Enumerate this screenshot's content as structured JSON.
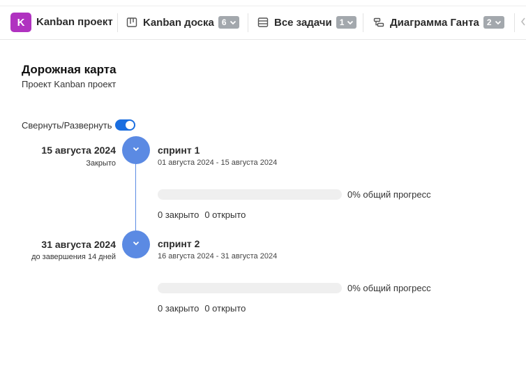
{
  "header": {
    "project_initial": "K",
    "project_name": "Kanban проект",
    "project_color": "#b032c0",
    "tabs": [
      {
        "label": "Kanban доска",
        "badge": "6",
        "icon": "board-icon"
      },
      {
        "label": "Все задачи",
        "badge": "1",
        "icon": "list-icon"
      },
      {
        "label": "Диаграмма Ганта",
        "badge": "2",
        "icon": "gantt-icon"
      }
    ]
  },
  "page": {
    "title": "Дорожная карта",
    "subtitle": "Проект Kanban проект",
    "collapse_label": "Свернуть/Развернуть",
    "collapse_enabled": true
  },
  "milestones": [
    {
      "date": "15 августа 2024",
      "status": "Закрыто",
      "sprint_name": "спринт 1",
      "sprint_start": "01 августа 2024",
      "sprint_end": "15 августа 2024",
      "progress_percent": 0,
      "progress_text": "0% общий прогресс",
      "closed_text": "0 закрыто",
      "open_text": "0 открыто"
    },
    {
      "date": "31 августа 2024",
      "status": "до завершения 14 дней",
      "sprint_name": "спринт 2",
      "sprint_start": "16 августа 2024",
      "sprint_end": "31 августа 2024",
      "progress_percent": 0,
      "progress_text": "0% общий прогресс",
      "closed_text": "0 закрыто",
      "open_text": "0 открыто"
    }
  ],
  "colors": {
    "accent": "#5b8ae3",
    "toggle": "#1a6ee0",
    "badge": "#a3a8ad"
  }
}
